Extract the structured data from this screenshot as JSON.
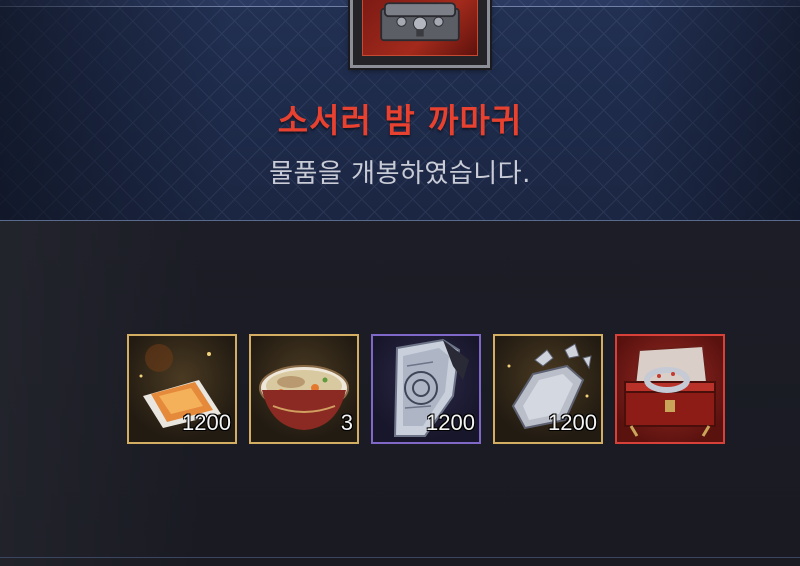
{
  "panel": {
    "title": "소서러 밤 까마귀",
    "message": "물품을 개봉하였습니다."
  },
  "rewards": [
    {
      "icon": "orange-scroll-icon",
      "grade": "gold",
      "quantity": "1200"
    },
    {
      "icon": "soup-bowl-icon",
      "grade": "gold",
      "quantity": "3"
    },
    {
      "icon": "silver-armor-piece-icon",
      "grade": "purple",
      "quantity": "1200"
    },
    {
      "icon": "silver-shard-icon",
      "grade": "gold",
      "quantity": "1200"
    },
    {
      "icon": "bracelet-chest-icon",
      "grade": "red",
      "quantity": ""
    }
  ],
  "colors": {
    "title": "#e8412f",
    "gold_border": "#d2ad62",
    "purple_border": "#8068c8",
    "red_border": "#d8413a"
  }
}
